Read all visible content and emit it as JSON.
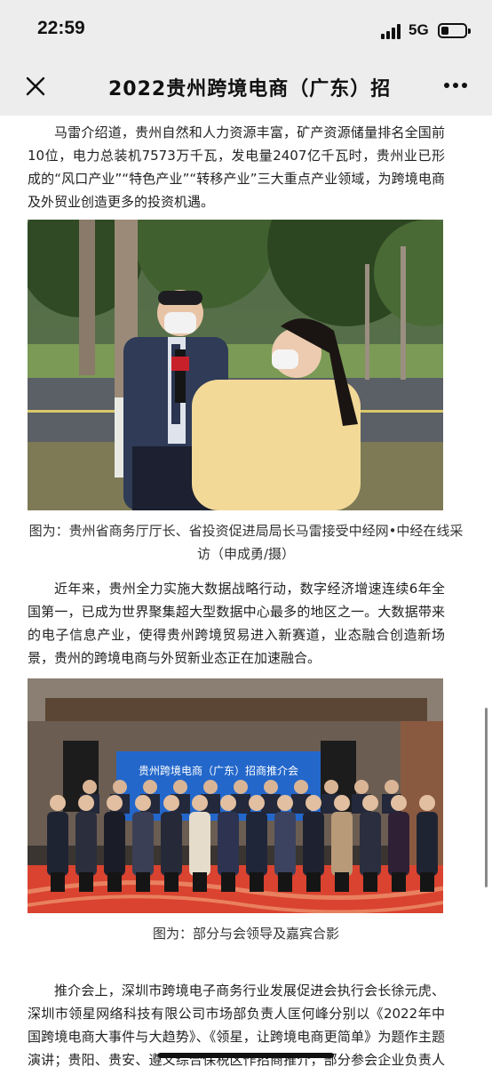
{
  "status_bar": {
    "time": "22:59",
    "network": "5G",
    "battery_level": 0.3,
    "signal_bars": 4
  },
  "nav": {
    "title": "2022贵州跨境电商（广东）招",
    "close_icon": "close-icon",
    "more_icon": "more-dots-icon"
  },
  "article": {
    "paragraph_1": "马雷介绍道，贵州自然和人力资源丰富，矿产资源储量排名全国前10位，电力总装机7573万千瓦，发电量2407亿千瓦时，贵州业已形成的“风口产业”“特色产业”“转移产业”三大重点产业领域，为跨境电商及外贸业创造更多的投资机遇。",
    "photo_1_caption": "图为：贵州省商务厅厅长、省投资促进局局长马雷接受中经网•中经在线采访（申成勇/摄）",
    "paragraph_2": "近年来，贵州全力实施大数据战略行动，数字经济增速连续6年全国第一，已成为世界聚集超大型数据中心最多的地区之一。大数据带来的电子信息产业，使得贵州跨境贸易进入新赛道，业态融合创造新场景，贵州的跨境电商与外贸新业态正在加速融合。",
    "photo_2_banner": "贵州跨境电商（广东）招商推介会",
    "photo_2_caption": "图为：部分与会领导及嘉宾合影",
    "paragraph_3": "推介会上，深圳市跨境电子商务行业发展促进会执行会长徐元虎、深圳市领星网络科技有限公司市场部负责人匡何峰分别以《2022年中国跨境电商大事件与大趋势》、《领星，让跨境电商更简单》为题作主题演讲；贵阳、贵安、遵义综合保税区作招商推介，部分参会企业负责人作交流发言。"
  },
  "colors": {
    "bar_bg": "#ededed",
    "text": "#222222",
    "stage_carpet": "#d9432f"
  }
}
